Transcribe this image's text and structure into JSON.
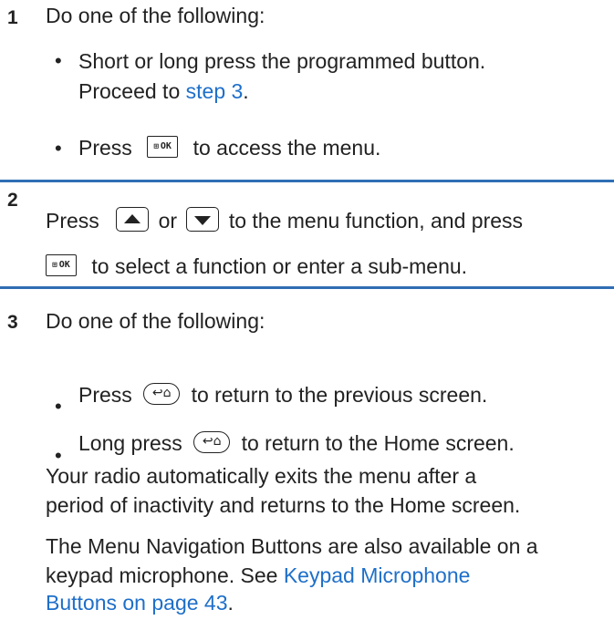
{
  "step1": {
    "number": "1",
    "intro": "Do one of the following:",
    "bullet": "•",
    "item1_line1": "Short or long press the programmed button.",
    "item1_line2_pre": "Proceed to ",
    "item1_link": "step 3",
    "item1_line2_post": ".",
    "item2_pre": "Press",
    "item2_post": "to access the menu."
  },
  "step2": {
    "number": "2",
    "line1_pre": "Press",
    "line1_mid": "or",
    "line1_post": "to the menu function, and press",
    "line2_post": "to select a function or enter a sub-menu."
  },
  "step3": {
    "number": "3",
    "intro": "Do one of the following:",
    "bullet": "•",
    "item1_pre": "Press",
    "item1_post": "to return to the previous screen.",
    "item2_pre": "Long press",
    "item2_post": "to return to the Home screen.",
    "para1_line1": "Your radio automatically exits the menu after a",
    "para1_line2": "period of inactivity and returns to the Home screen.",
    "para2_line1": "The Menu Navigation Buttons are also available on a",
    "para2_line2_pre": "keypad microphone. See ",
    "para2_link_line2": "Keypad Microphone",
    "para2_link_line3": "Buttons on page 43",
    "para2_line3_post": "."
  },
  "keys": {
    "ok_grid": "⊞",
    "ok_label": "OK",
    "back_label": "↩︎⌂",
    "up_icon": "up-arrow-key-icon",
    "down_icon": "down-arrow-key-icon"
  },
  "colors": {
    "rule": "#2f6eb4",
    "link": "#1e6fc9",
    "text": "#222222"
  }
}
